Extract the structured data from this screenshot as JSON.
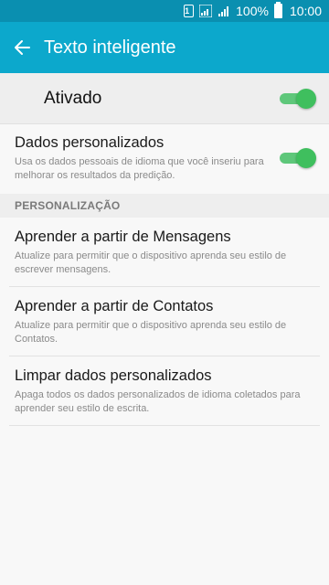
{
  "status_bar": {
    "sim_label": "1",
    "battery_text": "100%",
    "time": "10:00"
  },
  "toolbar": {
    "title": "Texto inteligente"
  },
  "master_switch": {
    "label": "Ativado",
    "on": true
  },
  "personal_data": {
    "title": "Dados personalizados",
    "subtitle": "Usa os dados pessoais de idioma que você inseriu para melhorar os resultados da predição.",
    "on": true
  },
  "section": {
    "header": "PERSONALIZAÇÃO"
  },
  "items": [
    {
      "title": "Aprender a partir de Mensagens",
      "subtitle": "Atualize para permitir que o dispositivo aprenda seu estilo de escrever mensagens."
    },
    {
      "title": "Aprender a partir de Contatos",
      "subtitle": "Atualize para permitir que o dispositivo aprenda seu estilo de Contatos."
    },
    {
      "title": "Limpar dados personalizados",
      "subtitle": "Apaga todos os dados personalizados de idioma coletados para aprender seu estilo de escrita."
    }
  ],
  "colors": {
    "status_bar": "#0a8fb0",
    "toolbar": "#0ca8cc",
    "switch_on": "#3fbf5e"
  }
}
